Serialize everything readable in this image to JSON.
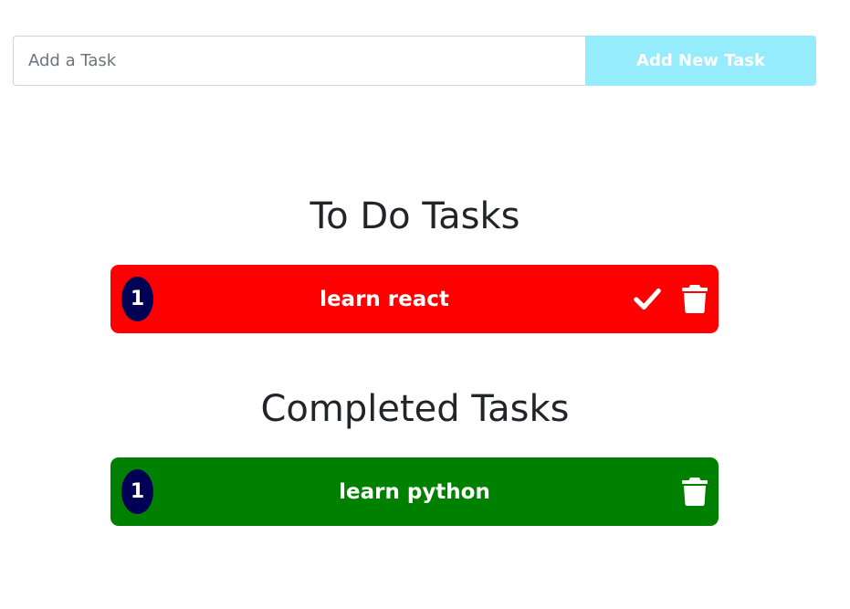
{
  "input": {
    "placeholder": "Add a Task",
    "value": ""
  },
  "add_button": {
    "label": "Add New Task",
    "color": "#94ecfc"
  },
  "todo": {
    "title": "To Do Tasks",
    "card_color": "#ff0000",
    "items": [
      {
        "number": "1",
        "text": "learn react",
        "actions": [
          "check-icon",
          "trash-icon"
        ]
      }
    ]
  },
  "completed": {
    "title": "Completed Tasks",
    "card_color": "#008000",
    "items": [
      {
        "number": "1",
        "text": "learn python",
        "actions": [
          "trash-icon"
        ]
      }
    ]
  },
  "badge_color": "#000055"
}
